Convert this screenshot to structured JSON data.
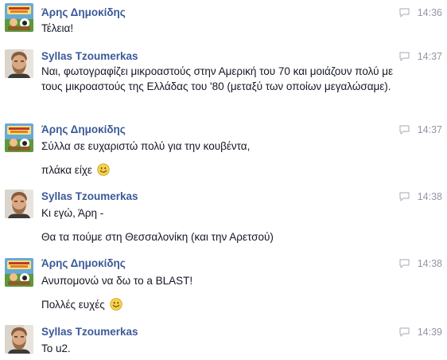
{
  "messages": [
    {
      "sender": "Άρης Δημοκίδης",
      "time": "14:36",
      "avatar": "cartoon-avatar",
      "lines": [
        "Τέλεια!"
      ]
    },
    {
      "sender": "Syllas Tzoumerkas",
      "time": "14:37",
      "avatar": "bearded-man-avatar",
      "lines": [
        "Ναι, φωτογραφίζει μικροαστούς στην Αμερική του 70 και μοιάζουν πολύ με τους μικροαστούς της Ελλάδας του '80 (μεταξύ των οποίων μεγαλώσαμε)."
      ]
    },
    {
      "sender": "Άρης Δημοκίδης",
      "time": "14:37",
      "avatar": "cartoon-avatar",
      "lines": [
        "Σύλλα σε ευχαριστώ πολύ για την κουβέντα,",
        "πλάκα είχε"
      ],
      "emoji": "smiley-icon"
    },
    {
      "sender": "Syllas Tzoumerkas",
      "time": "14:38",
      "avatar": "bearded-man-avatar",
      "lines": [
        "Κι εγώ, Άρη -",
        "Θα τα πούμε στη Θεσσαλονίκη (και την Αρετσού)"
      ]
    },
    {
      "sender": "Άρης Δημοκίδης",
      "time": "14:38",
      "avatar": "cartoon-avatar",
      "lines": [
        "Ανυπομονώ να δω το a BLAST!",
        "Πολλές ευχές"
      ],
      "emoji": "smiley-icon"
    },
    {
      "sender": "Syllas Tzoumerkas",
      "time": "14:39",
      "avatar": "bearded-man-avatar",
      "lines": [
        "Το u2."
      ]
    }
  ],
  "colors": {
    "sender": "#3b5998",
    "timestamp": "#9197a3",
    "text": "#141823"
  }
}
